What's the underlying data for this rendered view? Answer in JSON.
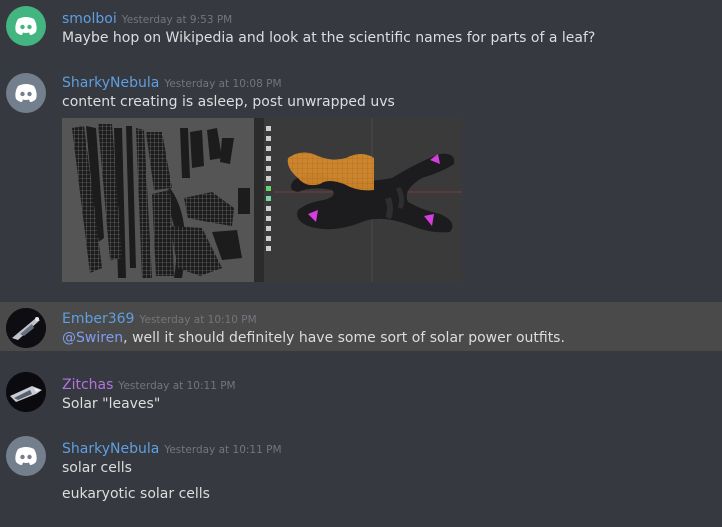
{
  "colors": {
    "discord_green": "#43b581",
    "discord_grey": "#747f8d",
    "link_blue": "#5f9fe0",
    "zitchas_purple": "#b473e0",
    "uv_orange": "#e8932b",
    "uv_magenta": "#d63ddf"
  },
  "messages": [
    {
      "username": "smolboi",
      "timestamp": "Yesterday at 9:53 PM",
      "avatar": "discord-logo-green",
      "lines": [
        "Maybe hop on Wikipedia and look at the scientific names for parts of a leaf?"
      ]
    },
    {
      "username": "SharkyNebula",
      "timestamp": "Yesterday at 10:08 PM",
      "avatar": "discord-logo-grey",
      "lines": [
        "content creating is asleep, post unwrapped uvs"
      ],
      "attachment": "uv-unwrap-screenshot"
    },
    {
      "username": "Ember369",
      "timestamp": "Yesterday at 10:10 PM",
      "avatar": "spaceship-avatar",
      "mention": "@Swiren",
      "text_after_mention": ", well it should definitely have some sort of solar power outfits."
    },
    {
      "username": "Zitchas",
      "timestamp": "Yesterday at 10:11 PM",
      "avatar": "spaceship-avatar",
      "lines": [
        "Solar \"leaves\""
      ]
    },
    {
      "username": "SharkyNebula",
      "timestamp": "Yesterday at 10:11 PM",
      "avatar": "discord-logo-grey",
      "lines": [
        "solar cells",
        "eukaryotic solar cells"
      ]
    }
  ]
}
